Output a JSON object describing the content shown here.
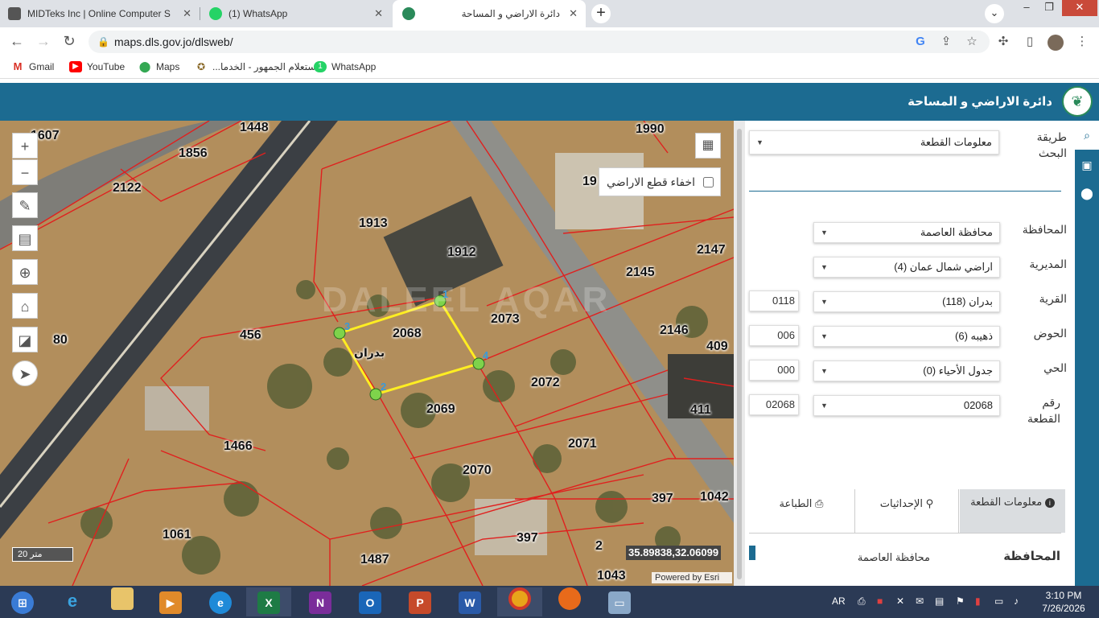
{
  "browser": {
    "tabs": [
      {
        "title": "MIDTeks Inc | Online Computer S",
        "icon": "midteks-favicon"
      },
      {
        "title": "(1) WhatsApp",
        "icon": "whatsapp-favicon"
      },
      {
        "title": "دائرة الاراضي و المساحة",
        "icon": "dls-favicon"
      }
    ],
    "address": "maps.dls.gov.jo/dlsweb/",
    "bookmarks": [
      "Gmail",
      "YouTube",
      "Maps",
      "استعلام الجمهور - الخدما...",
      "WhatsApp"
    ]
  },
  "app": {
    "header_title": "دائرة الاراضي و المساحة"
  },
  "map": {
    "hide_parcels_label": "اخفاء قطع الاراضي",
    "scale": "20 متر",
    "coordinates": "35.89838,32.06099",
    "attribution": "Powered by Esri",
    "watermark": "DALEEL AQAR",
    "area_label": "بدران",
    "parcels": [
      "1607",
      "1448",
      "1990",
      "1856",
      "2122",
      "1913",
      "19",
      "1912",
      "2147",
      "2145",
      "456",
      "2068",
      "2073",
      "2146",
      "409",
      "80",
      "2072",
      "2069",
      "411",
      "1466",
      "2071",
      "2070",
      "397",
      "1042",
      "1061",
      "397",
      "1487",
      "2",
      "1043",
      "1043"
    ],
    "vertices": [
      "1",
      "2",
      "3",
      "4"
    ]
  },
  "panel": {
    "search_method_label": "طريقة البحث",
    "search_method_value": "معلومات القطعة",
    "governorate_label": "المحافظة",
    "governorate_value": "محافظة العاصمة",
    "directorate_label": "المديرية",
    "directorate_value": "اراضي شمال عمان (4)",
    "village_label": "القرية",
    "village_value": "بدران (118)",
    "village_code": "0118",
    "basin_label": "الحوض",
    "basin_value": "ذهيبه (6)",
    "basin_code": "006",
    "neighborhood_label": "الحي",
    "neighborhood_value": "جدول الأحياء (0)",
    "neighborhood_code": "000",
    "parcel_label": "رقم القطعة",
    "parcel_value": "02068",
    "parcel_code": "02068",
    "tabs": [
      "معلومات القطعة",
      "الإحداثيات",
      "الطباعة"
    ],
    "bottom_text": "المحافظة",
    "bottom_value": "محافظة العاصمة"
  },
  "taskbar": {
    "language": "AR",
    "time": "3:10 PM",
    "date": "7/26/2026"
  }
}
